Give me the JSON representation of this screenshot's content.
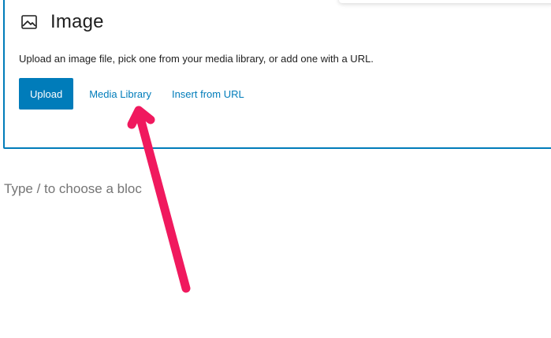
{
  "block": {
    "icon": "image-icon",
    "title": "Image",
    "instructions": "Upload an image file, pick one from your media library, or add one with a URL.",
    "upload_label": "Upload",
    "media_library_label": "Media Library",
    "insert_url_label": "Insert from URL"
  },
  "editor": {
    "placeholder": "Type / to choose a bloc"
  },
  "colors": {
    "accent": "#007cba",
    "annotation_arrow": "#f0195e",
    "text": "#1e1e1e",
    "placeholder": "#757575"
  }
}
